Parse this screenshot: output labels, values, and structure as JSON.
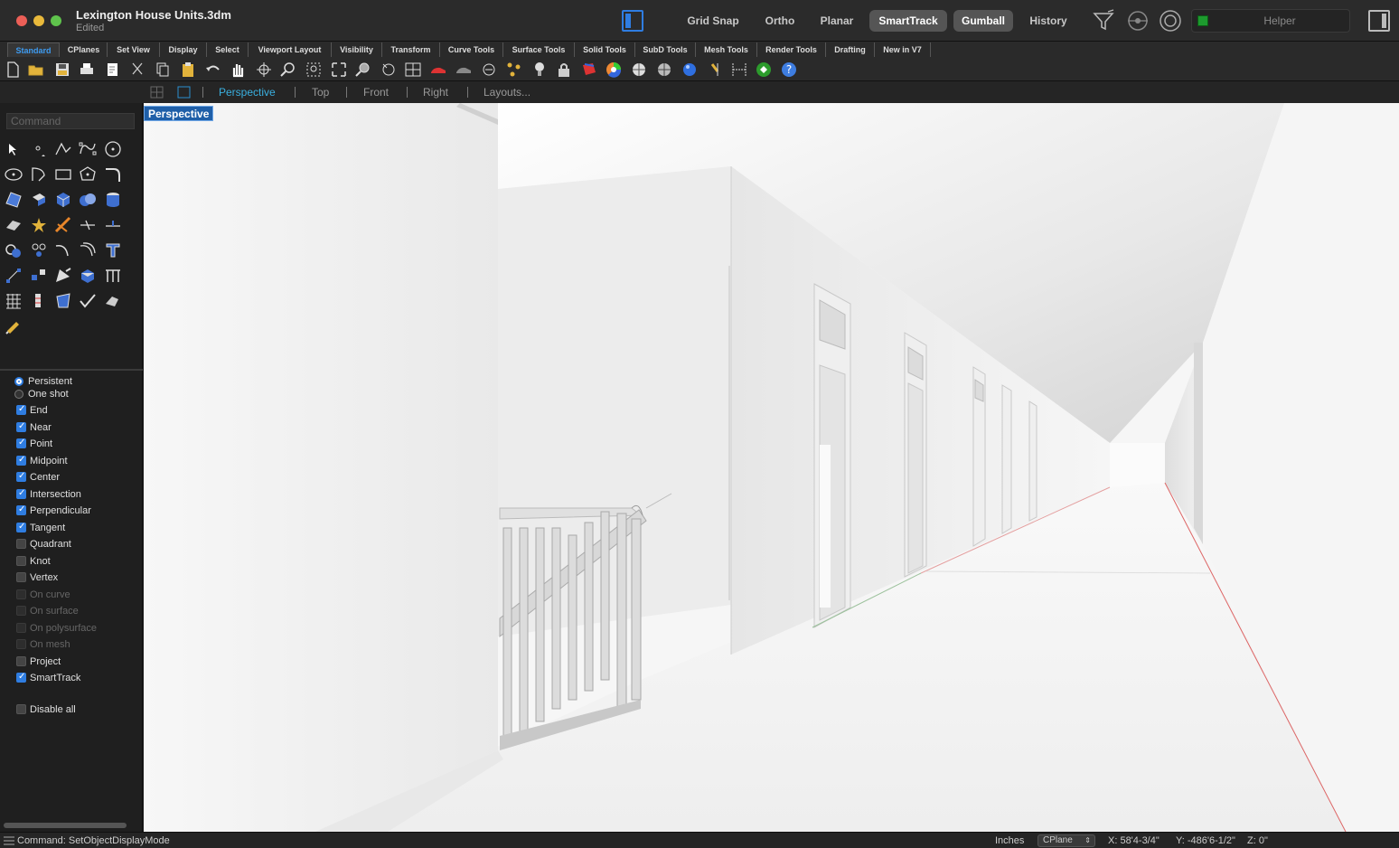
{
  "window": {
    "title": "Lexington House Units.3dm",
    "subtitle": "Edited"
  },
  "modes": {
    "grid_snap": "Grid Snap",
    "ortho": "Ortho",
    "planar": "Planar",
    "smarttrack": "SmartTrack",
    "gumball": "Gumball",
    "history": "History",
    "helper": "Helper"
  },
  "tabs": [
    "Standard",
    "CPlanes",
    "Set View",
    "Display",
    "Select",
    "Viewport Layout",
    "Visibility",
    "Transform",
    "Curve Tools",
    "Surface Tools",
    "Solid Tools",
    "SubD Tools",
    "Mesh Tools",
    "Render Tools",
    "Drafting",
    "New in V7"
  ],
  "view_tabs": {
    "perspective": "Perspective",
    "top": "Top",
    "front": "Front",
    "right": "Right",
    "layouts": "Layouts..."
  },
  "command": {
    "placeholder": "Command"
  },
  "osnap": {
    "persistent": "Persistent",
    "one_shot": "One shot",
    "items": [
      {
        "label": "End",
        "checked": true
      },
      {
        "label": "Near",
        "checked": true
      },
      {
        "label": "Point",
        "checked": true
      },
      {
        "label": "Midpoint",
        "checked": true
      },
      {
        "label": "Center",
        "checked": true
      },
      {
        "label": "Intersection",
        "checked": true
      },
      {
        "label": "Perpendicular",
        "checked": true
      },
      {
        "label": "Tangent",
        "checked": true
      },
      {
        "label": "Quadrant",
        "checked": false
      },
      {
        "label": "Knot",
        "checked": false
      },
      {
        "label": "Vertex",
        "checked": false
      },
      {
        "label": "On curve",
        "checked": false,
        "disabled": true
      },
      {
        "label": "On surface",
        "checked": false,
        "disabled": true
      },
      {
        "label": "On polysurface",
        "checked": false,
        "disabled": true
      },
      {
        "label": "On mesh",
        "checked": false,
        "disabled": true
      },
      {
        "label": "Project",
        "checked": false
      },
      {
        "label": "SmartTrack",
        "checked": true
      }
    ],
    "disable_all": "Disable all"
  },
  "viewport": {
    "label": "Perspective"
  },
  "status": {
    "command": "Command: SetObjectDisplayMode",
    "units": "Inches",
    "cplane": "CPlane",
    "x": "X: 58'4-3/4\"",
    "y": "Y: -486'6-1/2\"",
    "z": "Z: 0\""
  },
  "colors": {
    "accent": "#2f7de1",
    "viewport_label_bg": "#1f5fa8",
    "helper_indicator": "#1d9a2e"
  }
}
